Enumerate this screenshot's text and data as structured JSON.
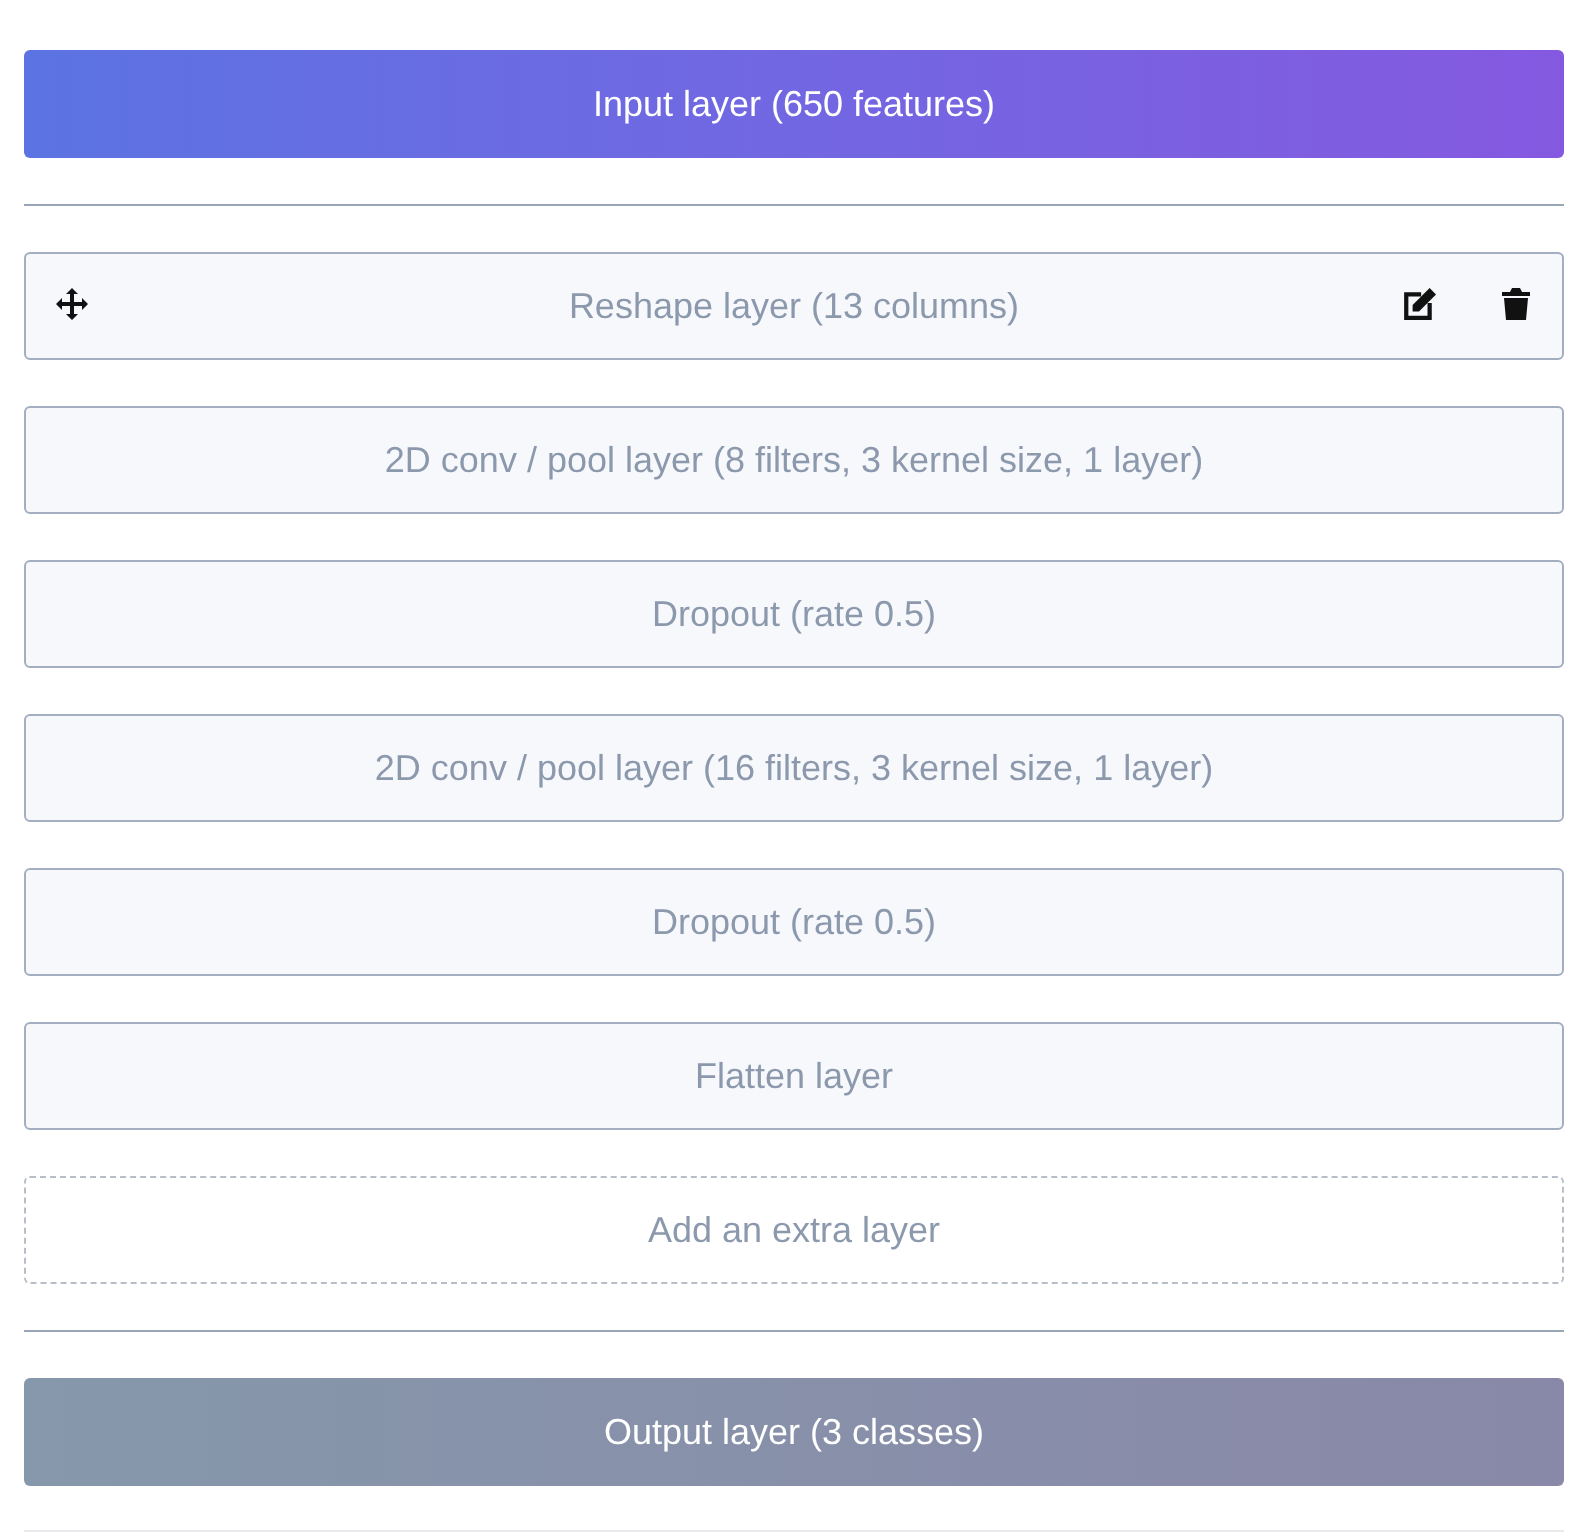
{
  "input_layer": {
    "label": "Input layer (650 features)"
  },
  "layers": [
    {
      "label": "Reshape layer (13 columns)",
      "controls_shown": true
    },
    {
      "label": "2D conv / pool layer (8 filters, 3 kernel size, 1 layer)",
      "controls_shown": false
    },
    {
      "label": "Dropout (rate 0.5)",
      "controls_shown": false
    },
    {
      "label": "2D conv / pool layer (16 filters, 3 kernel size, 1 layer)",
      "controls_shown": false
    },
    {
      "label": "Dropout (rate 0.5)",
      "controls_shown": false
    },
    {
      "label": "Flatten layer",
      "controls_shown": false
    }
  ],
  "add_layer": {
    "label": "Add an extra layer"
  },
  "output_layer": {
    "label": "Output layer (3 classes)"
  }
}
